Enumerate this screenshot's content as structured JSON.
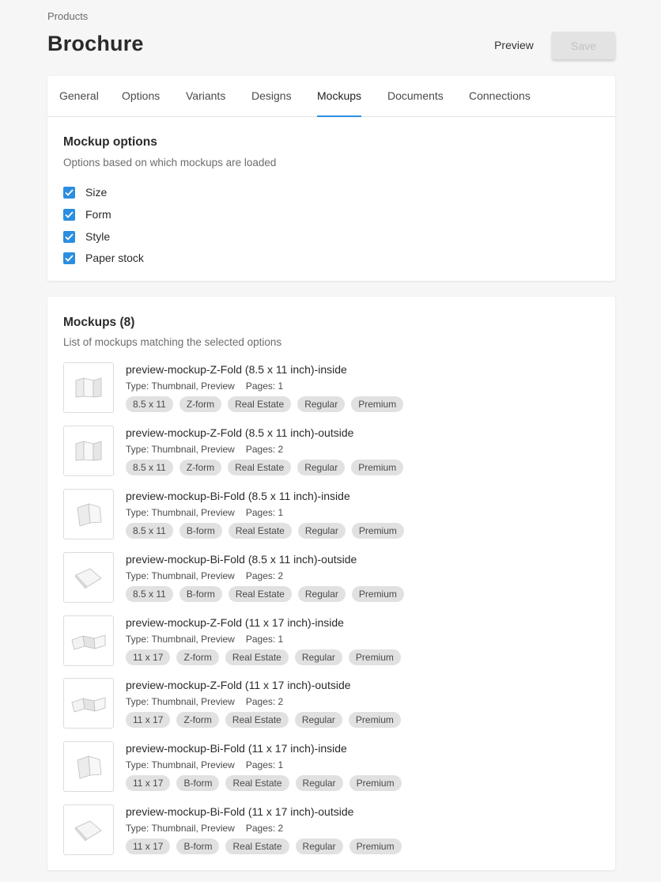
{
  "header": {
    "breadcrumb": "Products",
    "title": "Brochure",
    "preview_label": "Preview",
    "save_label": "Save"
  },
  "tabs": [
    {
      "label": "General"
    },
    {
      "label": "Options"
    },
    {
      "label": "Variants"
    },
    {
      "label": "Designs"
    },
    {
      "label": "Mockups",
      "active": true
    },
    {
      "label": "Documents"
    },
    {
      "label": "Connections"
    }
  ],
  "mockup_options": {
    "title": "Mockup options",
    "subtitle": "Options based on which mockups are loaded",
    "items": [
      {
        "label": "Size",
        "checked": true
      },
      {
        "label": "Form",
        "checked": true
      },
      {
        "label": "Style",
        "checked": true
      },
      {
        "label": "Paper stock",
        "checked": true
      }
    ]
  },
  "mockups": {
    "title": "Mockups (8)",
    "subtitle": "List of mockups matching the selected options",
    "items": [
      {
        "name": "preview-mockup-Z-Fold (8.5 x 11 inch)-inside",
        "type": "Type: Thumbnail, Preview",
        "pages": "Pages: 1",
        "thumb": "zfold-icon",
        "tags": [
          "8.5 x 11",
          "Z-form",
          "Real Estate",
          "Regular",
          "Premium"
        ]
      },
      {
        "name": "preview-mockup-Z-Fold (8.5 x 11 inch)-outside",
        "type": "Type: Thumbnail, Preview",
        "pages": "Pages: 2",
        "thumb": "zfold-icon",
        "tags": [
          "8.5 x 11",
          "Z-form",
          "Real Estate",
          "Regular",
          "Premium"
        ]
      },
      {
        "name": "preview-mockup-Bi-Fold (8.5 x 11 inch)-inside",
        "type": "Type: Thumbnail, Preview",
        "pages": "Pages: 1",
        "thumb": "bifold-icon",
        "tags": [
          "8.5 x 11",
          "B-form",
          "Real Estate",
          "Regular",
          "Premium"
        ]
      },
      {
        "name": "preview-mockup-Bi-Fold (8.5 x 11 inch)-outside",
        "type": "Type: Thumbnail, Preview",
        "pages": "Pages: 2",
        "thumb": "bifold-icon",
        "tags": [
          "8.5 x 11",
          "B-form",
          "Real Estate",
          "Regular",
          "Premium"
        ]
      },
      {
        "name": "preview-mockup-Z-Fold (11 x 17 inch)-inside",
        "type": "Type: Thumbnail, Preview",
        "pages": "Pages: 1",
        "thumb": "zfold-wide-icon",
        "tags": [
          "11 x 17",
          "Z-form",
          "Real Estate",
          "Regular",
          "Premium"
        ]
      },
      {
        "name": "preview-mockup-Z-Fold (11 x 17 inch)-outside",
        "type": "Type: Thumbnail, Preview",
        "pages": "Pages: 2",
        "thumb": "zfold-wide-icon",
        "tags": [
          "11 x 17",
          "Z-form",
          "Real Estate",
          "Regular",
          "Premium"
        ]
      },
      {
        "name": "preview-mockup-Bi-Fold (11 x 17 inch)-inside",
        "type": "Type: Thumbnail, Preview",
        "pages": "Pages: 1",
        "thumb": "bifold-icon",
        "tags": [
          "11 x 17",
          "B-form",
          "Real Estate",
          "Regular",
          "Premium"
        ]
      },
      {
        "name": "preview-mockup-Bi-Fold (11 x 17 inch)-outside",
        "type": "Type: Thumbnail, Preview",
        "pages": "Pages: 2",
        "thumb": "bifold-icon",
        "tags": [
          "11 x 17",
          "B-form",
          "Real Estate",
          "Regular",
          "Premium"
        ]
      }
    ]
  },
  "colors": {
    "accent": "#2b8ee0",
    "background": "#f6f6f6",
    "chip": "#e1e1e1"
  }
}
